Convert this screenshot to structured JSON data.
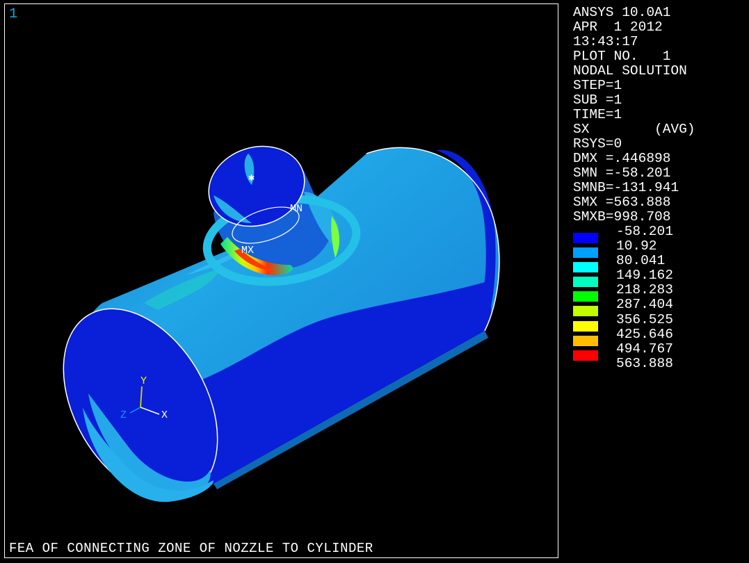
{
  "window": {
    "number": "1"
  },
  "header": {
    "lines": [
      "ANSYS 10.0A1",
      "APR  1 2012",
      "13:43:17",
      "PLOT NO.   1",
      "NODAL SOLUTION",
      "STEP=1",
      "SUB =1",
      "TIME=1",
      "SX        (AVG)",
      "RSYS=0",
      "DMX =.446898",
      "SMN =-58.201",
      "SMNB=-131.941",
      "SMX =563.888",
      "SMXB=998.708"
    ]
  },
  "legend": {
    "values": [
      "-58.201",
      "10.92",
      "80.041",
      "149.162",
      "218.283",
      "287.404",
      "356.525",
      "425.646",
      "494.767",
      "563.888"
    ],
    "colors": [
      "#0000ff",
      "#00a0ff",
      "#00ffff",
      "#00ffbf",
      "#00ff00",
      "#bfff00",
      "#ffff00",
      "#ffbf00",
      "#ff0000"
    ]
  },
  "model": {
    "min_label": "MN",
    "max_label": "MX",
    "axis_x": "X",
    "axis_y": "Y",
    "axis_z": "Z"
  },
  "caption": "FEA OF CONNECTING ZONE OF NOZZLE TO CYLINDER"
}
